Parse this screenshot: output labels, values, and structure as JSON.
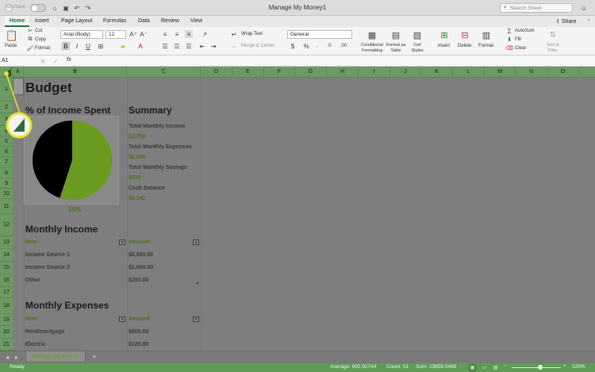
{
  "titlebar": {
    "autosave": "AutoSave",
    "toggle": "OFF",
    "title": "Manage My Money1",
    "search_placeholder": "Search Sheet"
  },
  "ribbon_tabs": [
    "Home",
    "Insert",
    "Page Layout",
    "Formulas",
    "Data",
    "Review",
    "View"
  ],
  "share_label": "Share",
  "clipboard": {
    "paste": "Paste",
    "cut": "Cut",
    "copy": "Copy",
    "format": "Format"
  },
  "font": {
    "name": "Arial (Body)",
    "size": "12"
  },
  "alignment": {
    "wrap": "Wrap Text",
    "merge": "Merge & Center"
  },
  "number": {
    "format": "General"
  },
  "styles": {
    "conditional": "Conditional Formatting",
    "format_table": "Format as Table",
    "cell_styles": "Cell Styles"
  },
  "cells": {
    "insert": "Insert",
    "delete": "Delete",
    "format": "Format"
  },
  "editing": {
    "autosum": "AutoSum",
    "fill": "Fill",
    "clear": "Clear",
    "sort": "Sort & Filter"
  },
  "formula_bar": {
    "cell_ref": "A1",
    "fx": "fx",
    "value": ""
  },
  "columns": [
    "A",
    "B",
    "C",
    "D",
    "E",
    "F",
    "G",
    "H",
    "I",
    "J",
    "K",
    "L",
    "M",
    "N",
    "O"
  ],
  "rows": [
    "1",
    "2",
    "3",
    "4",
    "5",
    "6",
    "7",
    "8",
    "9",
    "10",
    "11",
    "12",
    "13",
    "14",
    "15",
    "16",
    "17",
    "18",
    "19",
    "20",
    "21"
  ],
  "sheet": {
    "title": "Budget",
    "pct_heading": "% of Income Spent",
    "pct_value": "55%",
    "summary_heading": "Summary",
    "summary": [
      {
        "label": "Total Monthly Income",
        "value": "$3,750"
      },
      {
        "label": "Total Monthly Expenses",
        "value": "$2,058"
      },
      {
        "label": "Total Monthly Savings",
        "value": "$550"
      },
      {
        "label": "Cash Balance",
        "value": "$1,142"
      }
    ],
    "income_heading": "Monthly Income",
    "income_headers": {
      "item": "Item",
      "amount": "Amount"
    },
    "income_rows": [
      {
        "item": "Income Source 1",
        "amount": "$2,500.00"
      },
      {
        "item": "Income Source 2",
        "amount": "$1,000.00"
      },
      {
        "item": "Other",
        "amount": "$250.00"
      }
    ],
    "expenses_heading": "Monthly Expenses",
    "expense_headers": {
      "item": "Item",
      "amount": "Amount"
    },
    "expense_rows": [
      {
        "item": "Rent/mortgage",
        "amount": "$800.00"
      },
      {
        "item": "Electric",
        "amount": "$120.00"
      }
    ]
  },
  "pie": {
    "spent_fraction": 0.55,
    "spent_color": "#6a9a1f",
    "remaining_color": "#000000"
  },
  "sheet_tab": "Manage My Money",
  "status": {
    "ready": "Ready",
    "average": "Average: 692.92744",
    "count": "Count: 51",
    "sum": "Sum: 13858.5488",
    "zoom": "125%"
  },
  "colors": {
    "accent": "#217346",
    "highlight": "#e6e332"
  }
}
